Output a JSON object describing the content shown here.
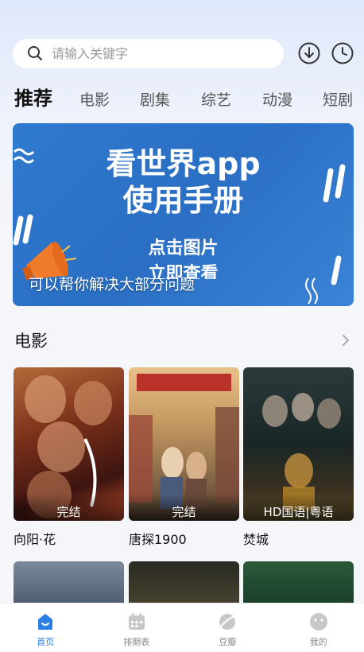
{
  "search": {
    "placeholder": "请输入关键字"
  },
  "tabs": [
    {
      "label": "推荐",
      "active": true
    },
    {
      "label": "电影"
    },
    {
      "label": "剧集"
    },
    {
      "label": "综艺"
    },
    {
      "label": "动漫"
    },
    {
      "label": "短剧"
    }
  ],
  "banner": {
    "title_line1": "看世界app",
    "title_line2": "使用手册",
    "sub_line1": "点击图片",
    "sub_line2": "立即查看",
    "caption": "可以帮你解决大部分问题"
  },
  "section": {
    "title": "电影"
  },
  "movies": [
    {
      "name": "向阳·花",
      "badge": "完结"
    },
    {
      "name": "唐探1900",
      "badge": "完结"
    },
    {
      "name": "焚城",
      "badge": "HD国语|粤语"
    }
  ],
  "nav": [
    {
      "label": "首页",
      "active": true
    },
    {
      "label": "排期表"
    },
    {
      "label": "豆瓣"
    },
    {
      "label": "我的"
    }
  ],
  "colors": {
    "accent": "#2d7fe6",
    "banner": "#2f79cf"
  }
}
